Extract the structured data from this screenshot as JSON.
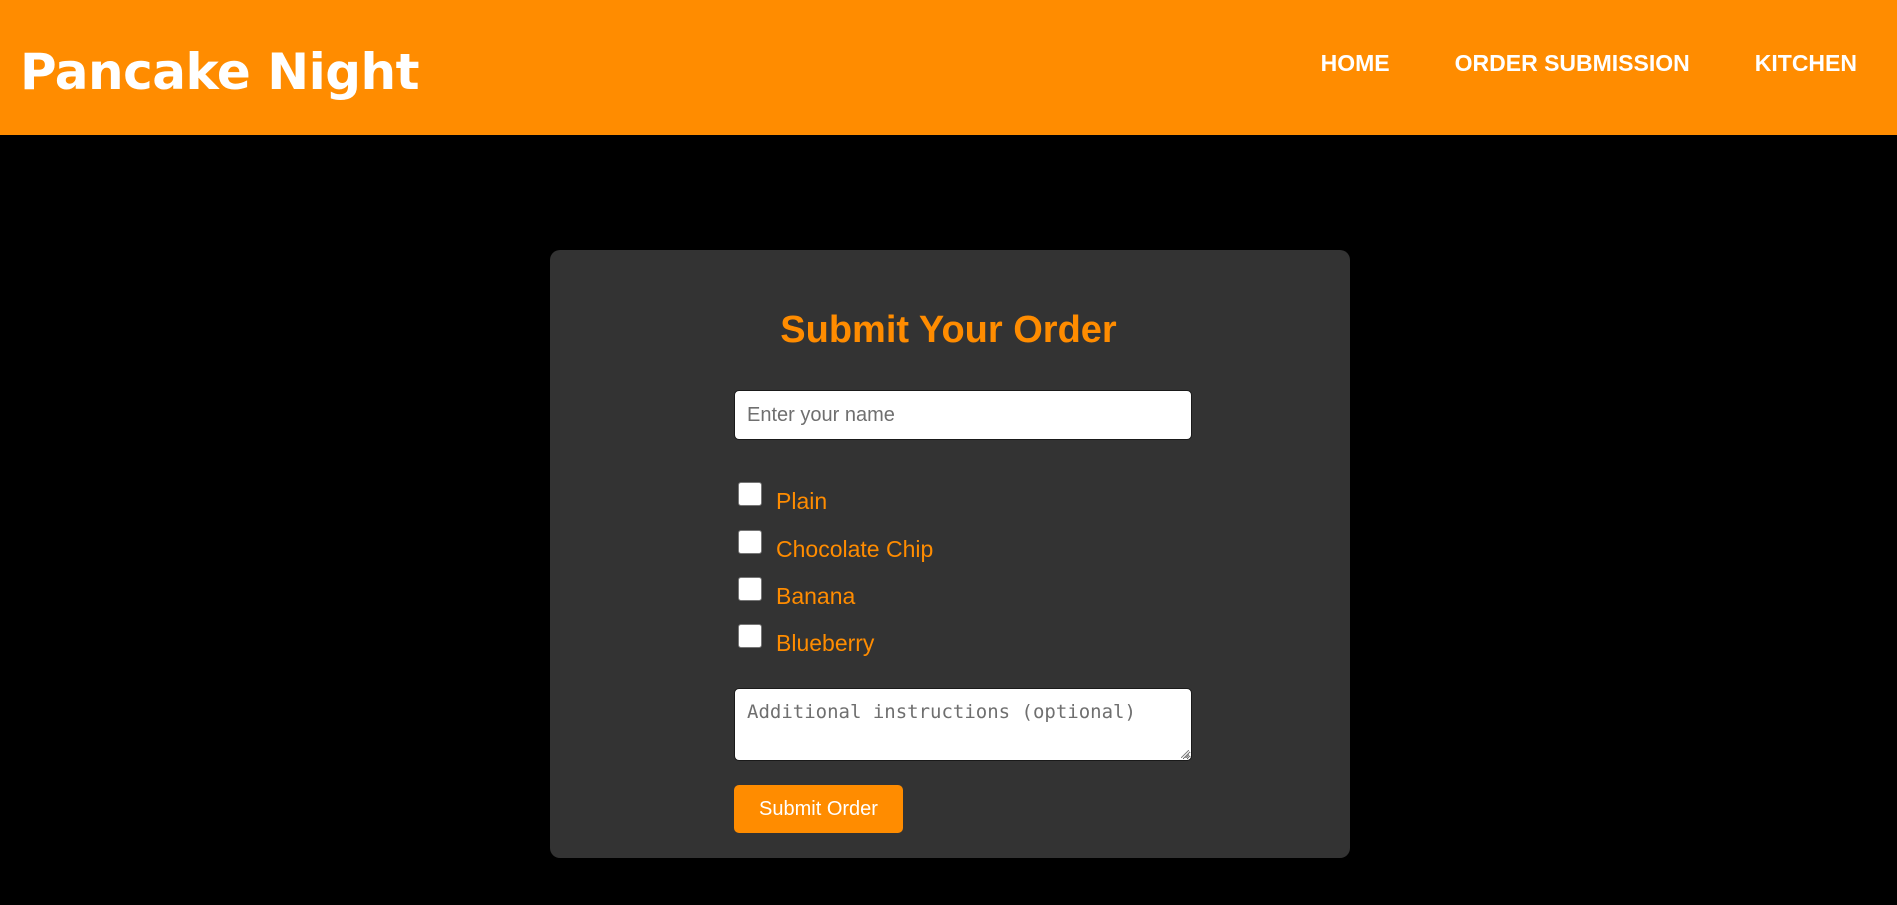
{
  "header": {
    "brand": "Pancake Night",
    "nav": [
      {
        "label": "HOME"
      },
      {
        "label": "ORDER SUBMISSION"
      },
      {
        "label": "KITCHEN"
      }
    ]
  },
  "form": {
    "title": "Submit Your Order",
    "name_placeholder": "Enter your name",
    "name_value": "",
    "options": [
      {
        "label": "Plain",
        "checked": false
      },
      {
        "label": "Chocolate Chip",
        "checked": false
      },
      {
        "label": "Banana",
        "checked": false
      },
      {
        "label": "Blueberry",
        "checked": false
      }
    ],
    "notes_placeholder": "Additional instructions (optional)",
    "submit_label": "Submit Order"
  },
  "colors": {
    "accent": "#ff8c00",
    "background": "#000000",
    "card": "#333333"
  }
}
